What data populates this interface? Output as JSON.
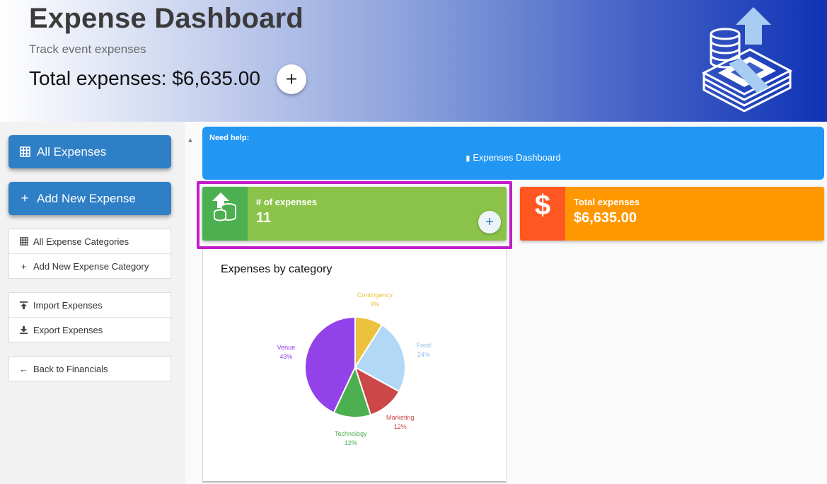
{
  "header": {
    "title": "Expense Dashboard",
    "subtitle": "Track event expenses",
    "total_text": "Total expenses: $6,635.00",
    "add_symbol": "+",
    "illustration_icon": "money-stack-upload-icon"
  },
  "sidebar": {
    "primary_buttons": [
      {
        "label": "All Expenses",
        "icon": "grid-icon"
      },
      {
        "label": "Add New Expense",
        "icon": "plus-icon"
      }
    ],
    "category_items": [
      {
        "label": "All Expense Categories",
        "icon": "grid-icon"
      },
      {
        "label": "Add New Expense Category",
        "icon": "plus-icon"
      }
    ],
    "io_items": [
      {
        "label": "Import Expenses",
        "icon": "upload-icon"
      },
      {
        "label": "Export Expenses",
        "icon": "download-icon"
      }
    ],
    "back_item": {
      "label": "Back to Financials",
      "icon": "arrow-left-icon"
    }
  },
  "help": {
    "label": "Need help:",
    "link_text": "Expenses Dashboard",
    "icon": "book-icon"
  },
  "cards": {
    "count": {
      "label": "# of expenses",
      "value": "11",
      "icon": "coins-upload-icon",
      "add_symbol": "+",
      "color": "#8bc34a",
      "icon_bg": "#4caf50"
    },
    "total": {
      "label": "Total expenses",
      "value": "$6,635.00",
      "icon": "dollar-icon",
      "symbol": "$",
      "color": "#ff9800",
      "icon_bg": "#ff5722"
    }
  },
  "chart_panel": {
    "title": "Expenses by category"
  },
  "chart_data": {
    "type": "pie",
    "title": "Expenses by category",
    "slices": [
      {
        "name": "Contingency",
        "percent": 9,
        "label": "9%",
        "color": "#ebc23e"
      },
      {
        "name": "Food",
        "percent": 24,
        "label": "24%",
        "color": "#b3d8f6"
      },
      {
        "name": "Marketing",
        "percent": 12,
        "label": "12%",
        "color": "#cc4747"
      },
      {
        "name": "Technology",
        "percent": 12,
        "label": "12%",
        "color": "#4caf50"
      },
      {
        "name": "Venue",
        "percent": 43,
        "label": "43%",
        "color": "#9341e8"
      }
    ]
  }
}
